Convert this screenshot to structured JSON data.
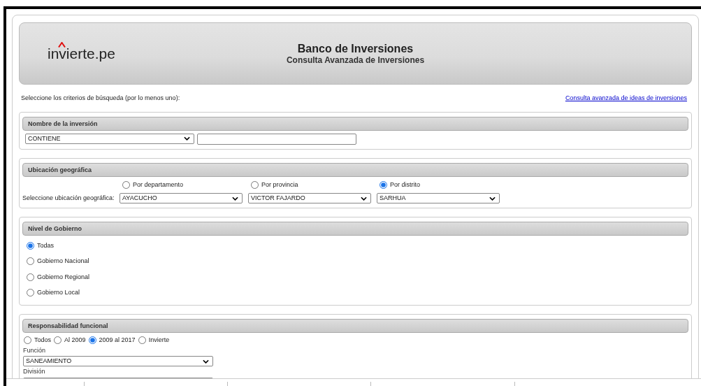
{
  "header": {
    "logo": "invierte.pe",
    "title": "Banco de Inversiones",
    "subtitle": "Consulta Avanzada de Inversiones"
  },
  "instructions": "Seleccione los criterios de búsqueda (por lo menos uno):",
  "link": "Consulta avanzada de ideas de inversiones",
  "sections": [
    {
      "kind": "name",
      "title": "Nombre de la inversión",
      "operator": "CONTIENE"
    },
    {
      "kind": "location",
      "title": "Ubicación geográfica",
      "label": "Seleccione ubicación geográfica:",
      "options": [
        {
          "label": "Por departamento",
          "selected": false,
          "value": "AYACUCHO"
        },
        {
          "label": "Por provincia",
          "selected": false,
          "value": "VICTOR FAJARDO"
        },
        {
          "label": "Por distrito",
          "selected": true,
          "value": "SARHUA"
        }
      ]
    },
    {
      "kind": "levels",
      "title": "Nivel de Gobierno",
      "options": [
        {
          "label": "Todas",
          "selected": true
        },
        {
          "label": "Gobierno Nacional",
          "selected": false
        },
        {
          "label": "Gobierno Regional",
          "selected": false
        },
        {
          "label": "Gobierno Local",
          "selected": false
        }
      ]
    },
    {
      "kind": "functional",
      "title": "Responsabilidad funcional",
      "options": [
        {
          "label": "Todos",
          "selected": false
        },
        {
          "label": "Al 2009",
          "selected": false
        },
        {
          "label": "2009 al 2017",
          "selected": true
        },
        {
          "label": "Invierte",
          "selected": false
        }
      ],
      "fields": [
        {
          "label": "Función",
          "value": "SANEAMIENTO"
        },
        {
          "label": "División"
        }
      ]
    }
  ]
}
